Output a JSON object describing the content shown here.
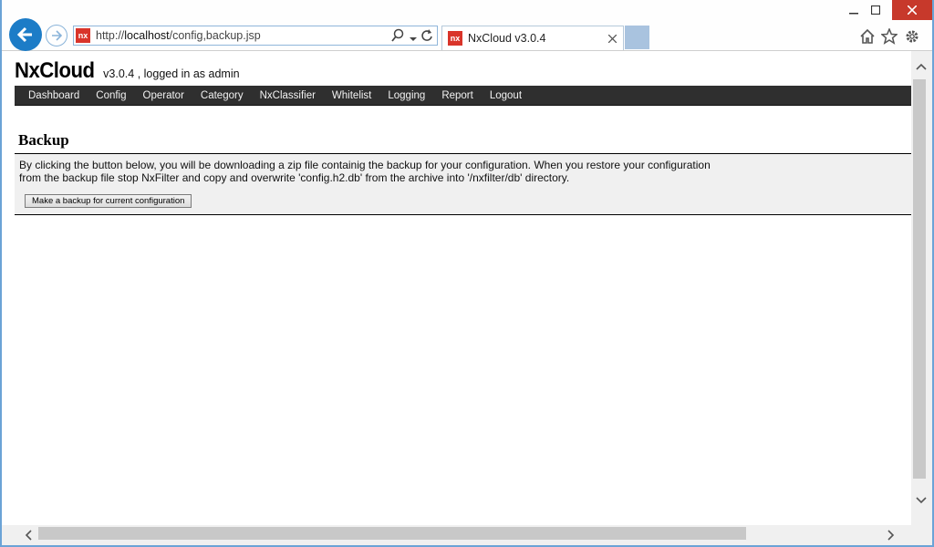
{
  "browser": {
    "address_protocol": "http://",
    "address_host": "localhost",
    "address_path": "/config,backup.jsp",
    "favicon_text": "nx",
    "tab_title": "NxCloud v3.0.4",
    "icons": [
      "back-arrow-icon",
      "forward-arrow-icon",
      "search-icon",
      "dropdown-icon",
      "refresh-icon",
      "close-icon",
      "home-icon",
      "star-icon",
      "gear-icon",
      "minimize-icon",
      "maximize-icon",
      "window-close-icon"
    ]
  },
  "header": {
    "brand": "NxCloud",
    "subtitle": "v3.0.4 , logged in as admin"
  },
  "nav": {
    "items": [
      "Dashboard",
      "Config",
      "Operator",
      "Category",
      "NxClassifier",
      "Whitelist",
      "Logging",
      "Report",
      "Logout"
    ]
  },
  "section": {
    "title": "Backup",
    "description": "By clicking the button below, you will be downloading a zip file containig the backup for your configuration. When you restore your configuration from the backup file stop NxFilter and copy and overwrite 'config.h2.db' from the archive into '/nxfilter/db' directory.",
    "button_label": "Make a backup for current configuration"
  },
  "colors": {
    "nav_bg": "#2f2f2f",
    "panel_bg": "#f0f0f0",
    "accent": "#1c7cc7",
    "close_red": "#c7392b"
  }
}
